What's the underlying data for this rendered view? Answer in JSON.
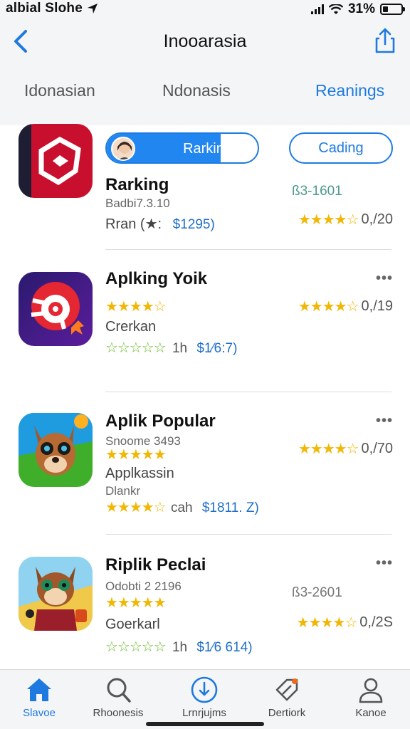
{
  "status_bar": {
    "carrier": "albial Slohe",
    "battery_percent": "31%",
    "battery_level": 0.31
  },
  "header": {
    "title": "Inooarasia"
  },
  "tabs": [
    {
      "label": "Idonasian",
      "active": false
    },
    {
      "label": "Ndonasis",
      "active": false
    },
    {
      "label": "Reanings",
      "active": true
    }
  ],
  "pills": {
    "ranking_label": "Rarking",
    "loading_label": "Cading"
  },
  "apps": [
    {
      "name": "Rarking",
      "subtitle": "Badbi7.3.10",
      "developer": "Rran (★:",
      "price": "$1295)",
      "meta": "ß3-1601",
      "rating": "0,/20",
      "rating_stars": 3.5,
      "icon": "red-hexagon-icon"
    },
    {
      "name": "Aplking Yoik",
      "developer": "Crerkan",
      "price": "$1⁄6:7)",
      "rating": "0,/19",
      "size": "1h",
      "rating_stars": 3.5,
      "icon": "red-gear-target-icon"
    },
    {
      "name": "Aplik Popular",
      "subtitle": "Snoome 3493",
      "developer": "Applkassin",
      "developer_line2": "Dlankr",
      "price": "$1811. Z)",
      "size": "cah",
      "rating": "0,/70",
      "rating_stars": 3.5,
      "icon": "cartoon-dog-icon"
    },
    {
      "name": "Riplik Peclai",
      "subtitle": "Odobti 2 2196",
      "developer": "Goerkarl",
      "price": "$1⁄6 614)",
      "meta": "ß3-2601",
      "size": "1h",
      "rating": "0,/2S",
      "rating_stars": 3.5,
      "icon": "cartoon-cat-icon"
    }
  ],
  "tabbar": [
    {
      "label": "Slavoe",
      "icon": "home-icon",
      "active": true
    },
    {
      "label": "Rhoonesis",
      "icon": "search-icon",
      "active": false
    },
    {
      "label": "Lrnrjujms",
      "icon": "download-icon",
      "active": false
    },
    {
      "label": "Dertiork",
      "icon": "pen-tag-icon",
      "active": false
    },
    {
      "label": "Kanoe",
      "icon": "profile-icon",
      "active": false
    }
  ],
  "colors": {
    "accent": "#1e7ae0",
    "star": "#f2b705",
    "green_star": "#6fbf2f"
  }
}
